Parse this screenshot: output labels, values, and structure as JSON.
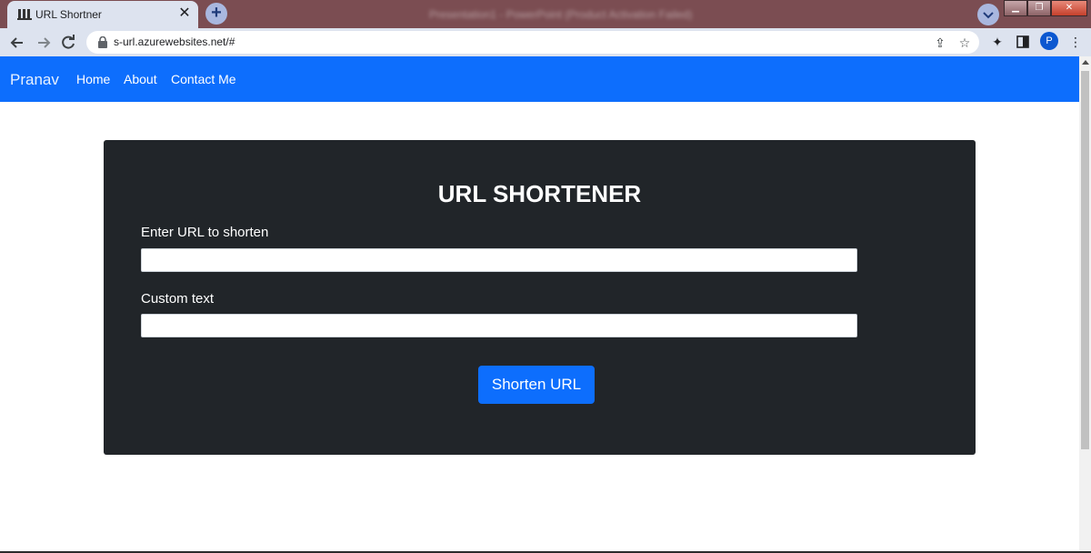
{
  "browser": {
    "tab_title": "URL Shortner",
    "tab_close": "✕",
    "new_tab": "+",
    "blurred_window_title": "Presentation1 - PowerPoint (Product Activation Failed)",
    "url": "s-url.azurewebsites.net/#",
    "profile_initial": "P"
  },
  "navbar": {
    "brand": "Pranav",
    "links": [
      "Home",
      "About",
      "Contact Me"
    ],
    "color": "#0d6efd"
  },
  "form": {
    "title": "URL SHORTENER",
    "url_label": "Enter URL to shorten",
    "url_value": "",
    "custom_label": "Custom text",
    "custom_value": "",
    "submit_label": "Shorten URL",
    "card_color": "#212529"
  }
}
